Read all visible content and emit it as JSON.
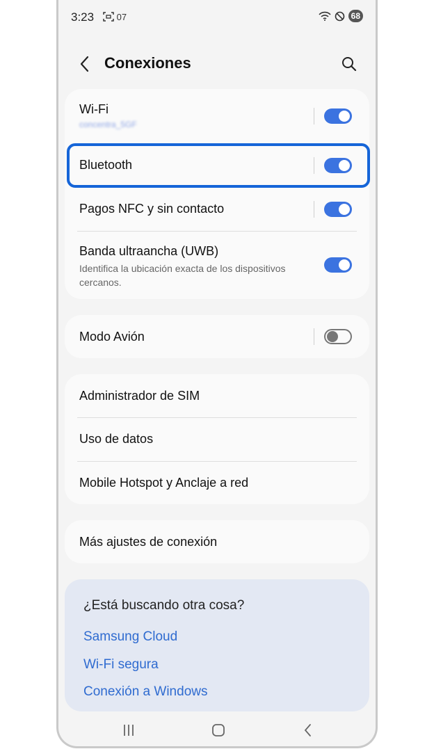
{
  "status_bar": {
    "time": "3:23",
    "notif_text": "07",
    "battery": "68"
  },
  "header": {
    "title": "Conexiones"
  },
  "group1": {
    "wifi": {
      "label": "Wi-Fi",
      "network": "concentra_5GF",
      "enabled": true
    },
    "bluetooth": {
      "label": "Bluetooth",
      "enabled": true
    },
    "nfc": {
      "label": "Pagos NFC y sin contacto",
      "enabled": true
    },
    "uwb": {
      "label": "Banda ultraancha (UWB)",
      "sub_line1": "Identifica la ubicación exacta de los dispositivos",
      "sub_line2": "cercanos.",
      "enabled": true
    }
  },
  "group2": {
    "airplane": {
      "label": "Modo Avión",
      "enabled": false
    }
  },
  "group3": {
    "sim": "Administrador de SIM",
    "data_usage": "Uso de datos",
    "hotspot": "Mobile Hotspot y Anclaje a red"
  },
  "group4": {
    "more": "Más ajustes de conexión"
  },
  "suggestions": {
    "question": "¿Está buscando otra cosa?",
    "links": [
      "Samsung Cloud",
      "Wi-Fi segura",
      "Conexión a Windows"
    ]
  },
  "colors": {
    "accent": "#3b73e0",
    "highlight": "#1565d8",
    "link": "#2f6bd0"
  }
}
